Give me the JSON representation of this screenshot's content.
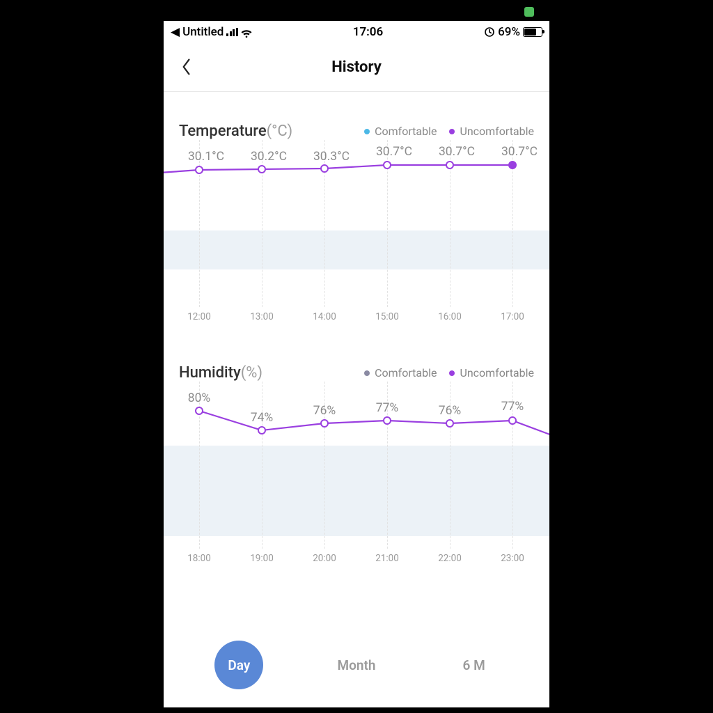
{
  "status_bar": {
    "app_name": "Untitled",
    "time": "17:06",
    "battery": "69%"
  },
  "header": {
    "title": "History"
  },
  "charts": {
    "temperature": {
      "title": "Temperature",
      "unit": "(°C)",
      "legend": {
        "comfortable": "Comfortable",
        "uncomfortable": "Uncomfortable"
      }
    },
    "humidity": {
      "title": "Humidity",
      "unit": "(%)",
      "legend": {
        "comfortable": "Comfortable",
        "uncomfortable": "Uncomfortable"
      }
    }
  },
  "tabs": {
    "day": "Day",
    "month": "Month",
    "six_m": "6 M"
  },
  "chart_data": [
    {
      "type": "line",
      "title": "Temperature (°C)",
      "series_status": "uncomfortable",
      "legend": [
        "Comfortable",
        "Uncomfortable"
      ],
      "x": [
        "12:00",
        "13:00",
        "14:00",
        "15:00",
        "16:00",
        "17:00"
      ],
      "values": [
        30.1,
        30.2,
        30.3,
        30.7,
        30.7,
        30.7
      ],
      "value_labels": [
        "30.1°C",
        "30.2°C",
        "30.3°C",
        "30.7°C",
        "30.7°C",
        "30.7°C"
      ],
      "xlabel": "",
      "ylabel": "°C",
      "ylim": [
        28,
        31
      ]
    },
    {
      "type": "line",
      "title": "Humidity (%)",
      "series_status": "uncomfortable",
      "legend": [
        "Comfortable",
        "Uncomfortable"
      ],
      "x": [
        "18:00",
        "19:00",
        "20:00",
        "21:00",
        "22:00",
        "23:00"
      ],
      "values": [
        80,
        74,
        76,
        77,
        76,
        77
      ],
      "value_labels": [
        "80%",
        "74%",
        "76%",
        "77%",
        "76%",
        "77%"
      ],
      "xlabel": "",
      "ylabel": "%",
      "ylim": [
        50,
        85
      ]
    }
  ]
}
